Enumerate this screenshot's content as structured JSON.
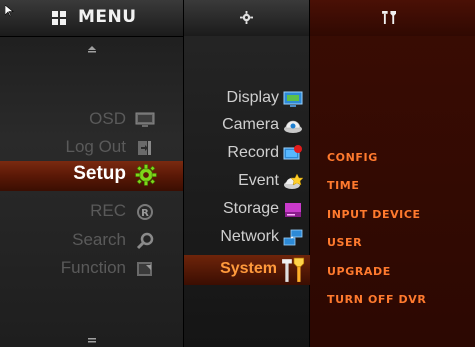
{
  "header": {
    "menu_title": "MENU",
    "menu_icon": "grid-icon",
    "mid_icon": "gear-icon",
    "right_icon": "tools-icon"
  },
  "left_menu": {
    "items": [
      {
        "label": "OSD",
        "icon": "monitor-icon"
      },
      {
        "label": "Log Out",
        "icon": "logout-icon"
      },
      {
        "label": "Setup",
        "icon": "gear-icon",
        "active": true
      },
      {
        "label": "REC",
        "icon": "record-icon"
      },
      {
        "label": "Search",
        "icon": "magnifier-icon"
      },
      {
        "label": "Function",
        "icon": "function-icon"
      }
    ]
  },
  "setup_menu": {
    "items": [
      {
        "label": "Display",
        "icon": "display-icon"
      },
      {
        "label": "Camera",
        "icon": "camera-icon"
      },
      {
        "label": "Record",
        "icon": "record-settings-icon"
      },
      {
        "label": "Event",
        "icon": "event-icon"
      },
      {
        "label": "Storage",
        "icon": "storage-icon"
      },
      {
        "label": "Network",
        "icon": "network-icon"
      },
      {
        "label": "System",
        "icon": "tools-icon",
        "active": true
      }
    ]
  },
  "system_menu": {
    "items": [
      "CONFIG",
      "TIME",
      "INPUT DEVICE",
      "USER",
      "UPGRADE",
      "TURN OFF DVR"
    ]
  },
  "colors": {
    "active_orange": "#ff7a2e",
    "active_bg": "#5a1806",
    "inactive_text": "#5a5a5a",
    "mid_text": "#cfcfcf"
  }
}
